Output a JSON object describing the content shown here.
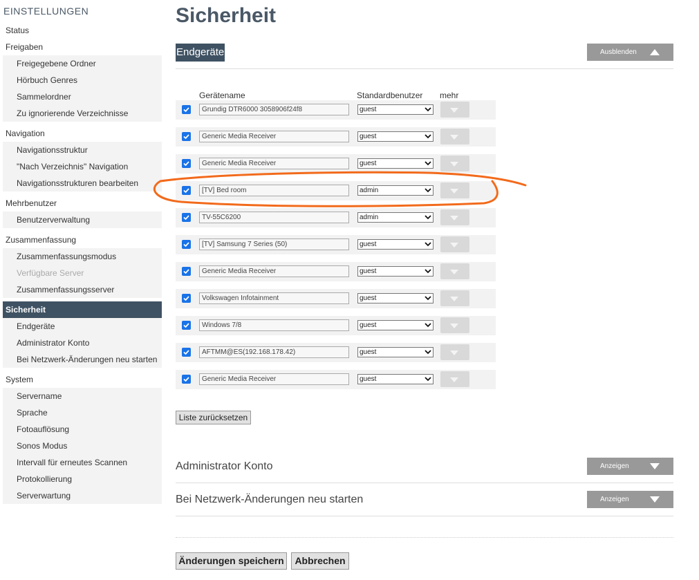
{
  "sidebar": {
    "heading": "EINSTELLUNGEN",
    "groups": [
      {
        "title": "Status",
        "items": []
      },
      {
        "title": "Freigaben",
        "items": [
          "Freigegebene Ordner",
          "Hörbuch Genres",
          "Sammelordner",
          "Zu ignorierende Verzeichnisse"
        ]
      },
      {
        "title": "Navigation",
        "items": [
          "Navigationsstruktur",
          "\"Nach Verzeichnis\" Navigation",
          "Navigationsstrukturen bearbeiten"
        ]
      },
      {
        "title": "Mehrbenutzer",
        "items": [
          "Benutzerverwaltung"
        ]
      },
      {
        "title": "Zusammenfassung",
        "items": [
          "Zusammenfassungsmodus",
          "Verfügbare Server",
          "Zusammenfassungsserver"
        ]
      },
      {
        "title": "Sicherheit",
        "items": [
          "Endgeräte",
          "Administrator Konto",
          "Bei Netzwerk-Änderungen neu starten"
        ]
      },
      {
        "title": "System",
        "items": [
          "Servername",
          "Sprache",
          "Fotoauflösung",
          "Sonos Modus",
          "Intervall für erneutes Scannen",
          "Protokollierung",
          "Serverwartung"
        ]
      }
    ]
  },
  "main": {
    "title": "Sicherheit",
    "section_endgeraete": {
      "title": "Endgeräte",
      "toggle_label": "Ausblenden",
      "col_name": "Gerätename",
      "col_user": "Standardbenutzer",
      "col_more": "mehr",
      "devices": [
        {
          "name": "Grundig DTR6000 3058906f24f8",
          "user": "guest",
          "checked": true
        },
        {
          "name": "Generic Media Receiver",
          "user": "guest",
          "checked": true
        },
        {
          "name": "Generic Media Receiver",
          "user": "guest",
          "checked": true
        },
        {
          "name": "[TV] Bed room",
          "user": "admin",
          "checked": true
        },
        {
          "name": "TV-55C6200",
          "user": "admin",
          "checked": true
        },
        {
          "name": "[TV] Samsung 7 Series (50)",
          "user": "guest",
          "checked": true
        },
        {
          "name": "Generic Media Receiver",
          "user": "guest",
          "checked": true
        },
        {
          "name": "Volkswagen Infotainment",
          "user": "guest",
          "checked": true
        },
        {
          "name": "Windows 7/8",
          "user": "guest",
          "checked": true
        },
        {
          "name": "AFTMM@ES(192.168.178.42)",
          "user": "guest",
          "checked": true
        },
        {
          "name": "Generic Media Receiver",
          "user": "guest",
          "checked": true
        }
      ],
      "reset_label": "Liste zurücksetzen"
    },
    "section_admin": {
      "title": "Administrator Konto",
      "toggle_label": "Anzeigen"
    },
    "section_restart": {
      "title": "Bei Netzwerk-Änderungen neu starten",
      "toggle_label": "Anzeigen"
    },
    "save_label": "Änderungen speichern",
    "cancel_label": "Abbrechen"
  },
  "colors": {
    "accent": "#3f5263",
    "annotation": "#f26a1b",
    "checkbox": "#1a73e8",
    "toggle": "#999999"
  }
}
